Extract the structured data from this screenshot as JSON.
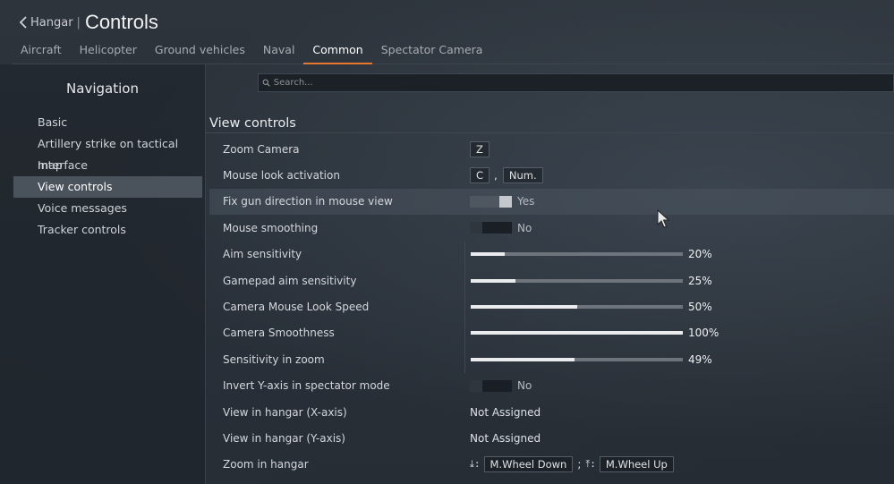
{
  "header": {
    "back_label": "Hangar",
    "separator": "|",
    "title": "Controls"
  },
  "tabs": [
    {
      "label": "Aircraft"
    },
    {
      "label": "Helicopter"
    },
    {
      "label": "Ground vehicles"
    },
    {
      "label": "Naval"
    },
    {
      "label": "Common",
      "active": true
    },
    {
      "label": "Spectator Camera"
    }
  ],
  "sidebar": {
    "title": "Navigation",
    "items": [
      {
        "label": "Basic"
      },
      {
        "label": "Artillery strike on tactical map"
      },
      {
        "label": "Interface"
      },
      {
        "label": "View controls",
        "active": true
      },
      {
        "label": "Voice messages"
      },
      {
        "label": "Tracker controls"
      }
    ]
  },
  "search": {
    "placeholder": "Search..."
  },
  "section": {
    "title": "View controls"
  },
  "rows": {
    "zoom_camera": {
      "label": "Zoom Camera",
      "key": "Z"
    },
    "mouse_look": {
      "label": "Mouse look activation",
      "key1": "C",
      "sep": ",",
      "key2": "Num."
    },
    "fix_gun": {
      "label": "Fix gun direction in mouse view",
      "state": "Yes",
      "on": true
    },
    "mouse_smoothing": {
      "label": "Mouse smoothing",
      "state": "No",
      "on": false
    },
    "aim_sens": {
      "label": "Aim sensitivity",
      "value_text": "20%",
      "value": 0.16
    },
    "gamepad_aim_sens": {
      "label": "Gamepad aim sensitivity",
      "value_text": "25%",
      "value": 0.21
    },
    "camera_mouse_look": {
      "label": "Camera Mouse Look Speed",
      "value_text": "50%",
      "value": 0.5
    },
    "camera_smoothness": {
      "label": "Camera Smoothness",
      "value_text": "100%",
      "value": 1.0
    },
    "sens_zoom": {
      "label": "Sensitivity in zoom",
      "value_text": "49%",
      "value": 0.49
    },
    "invert_y": {
      "label": "Invert Y-axis in spectator mode",
      "state": "No",
      "on": false
    },
    "hangar_x": {
      "label": "View in hangar (X-axis)",
      "value": "Not Assigned"
    },
    "hangar_y": {
      "label": "View in hangar (Y-axis)",
      "value": "Not Assigned"
    },
    "zoom_hangar": {
      "label": "Zoom in hangar",
      "down_icon": "⤓:",
      "down_key": "M.Wheel Down",
      "sep": ";",
      "up_icon": "⤒:",
      "up_key": "M.Wheel Up"
    }
  },
  "icons": {
    "back": "chevron-left-icon",
    "search": "search-icon",
    "cursor": "mouse-pointer-icon"
  },
  "colors": {
    "accent": "#e8762d"
  }
}
